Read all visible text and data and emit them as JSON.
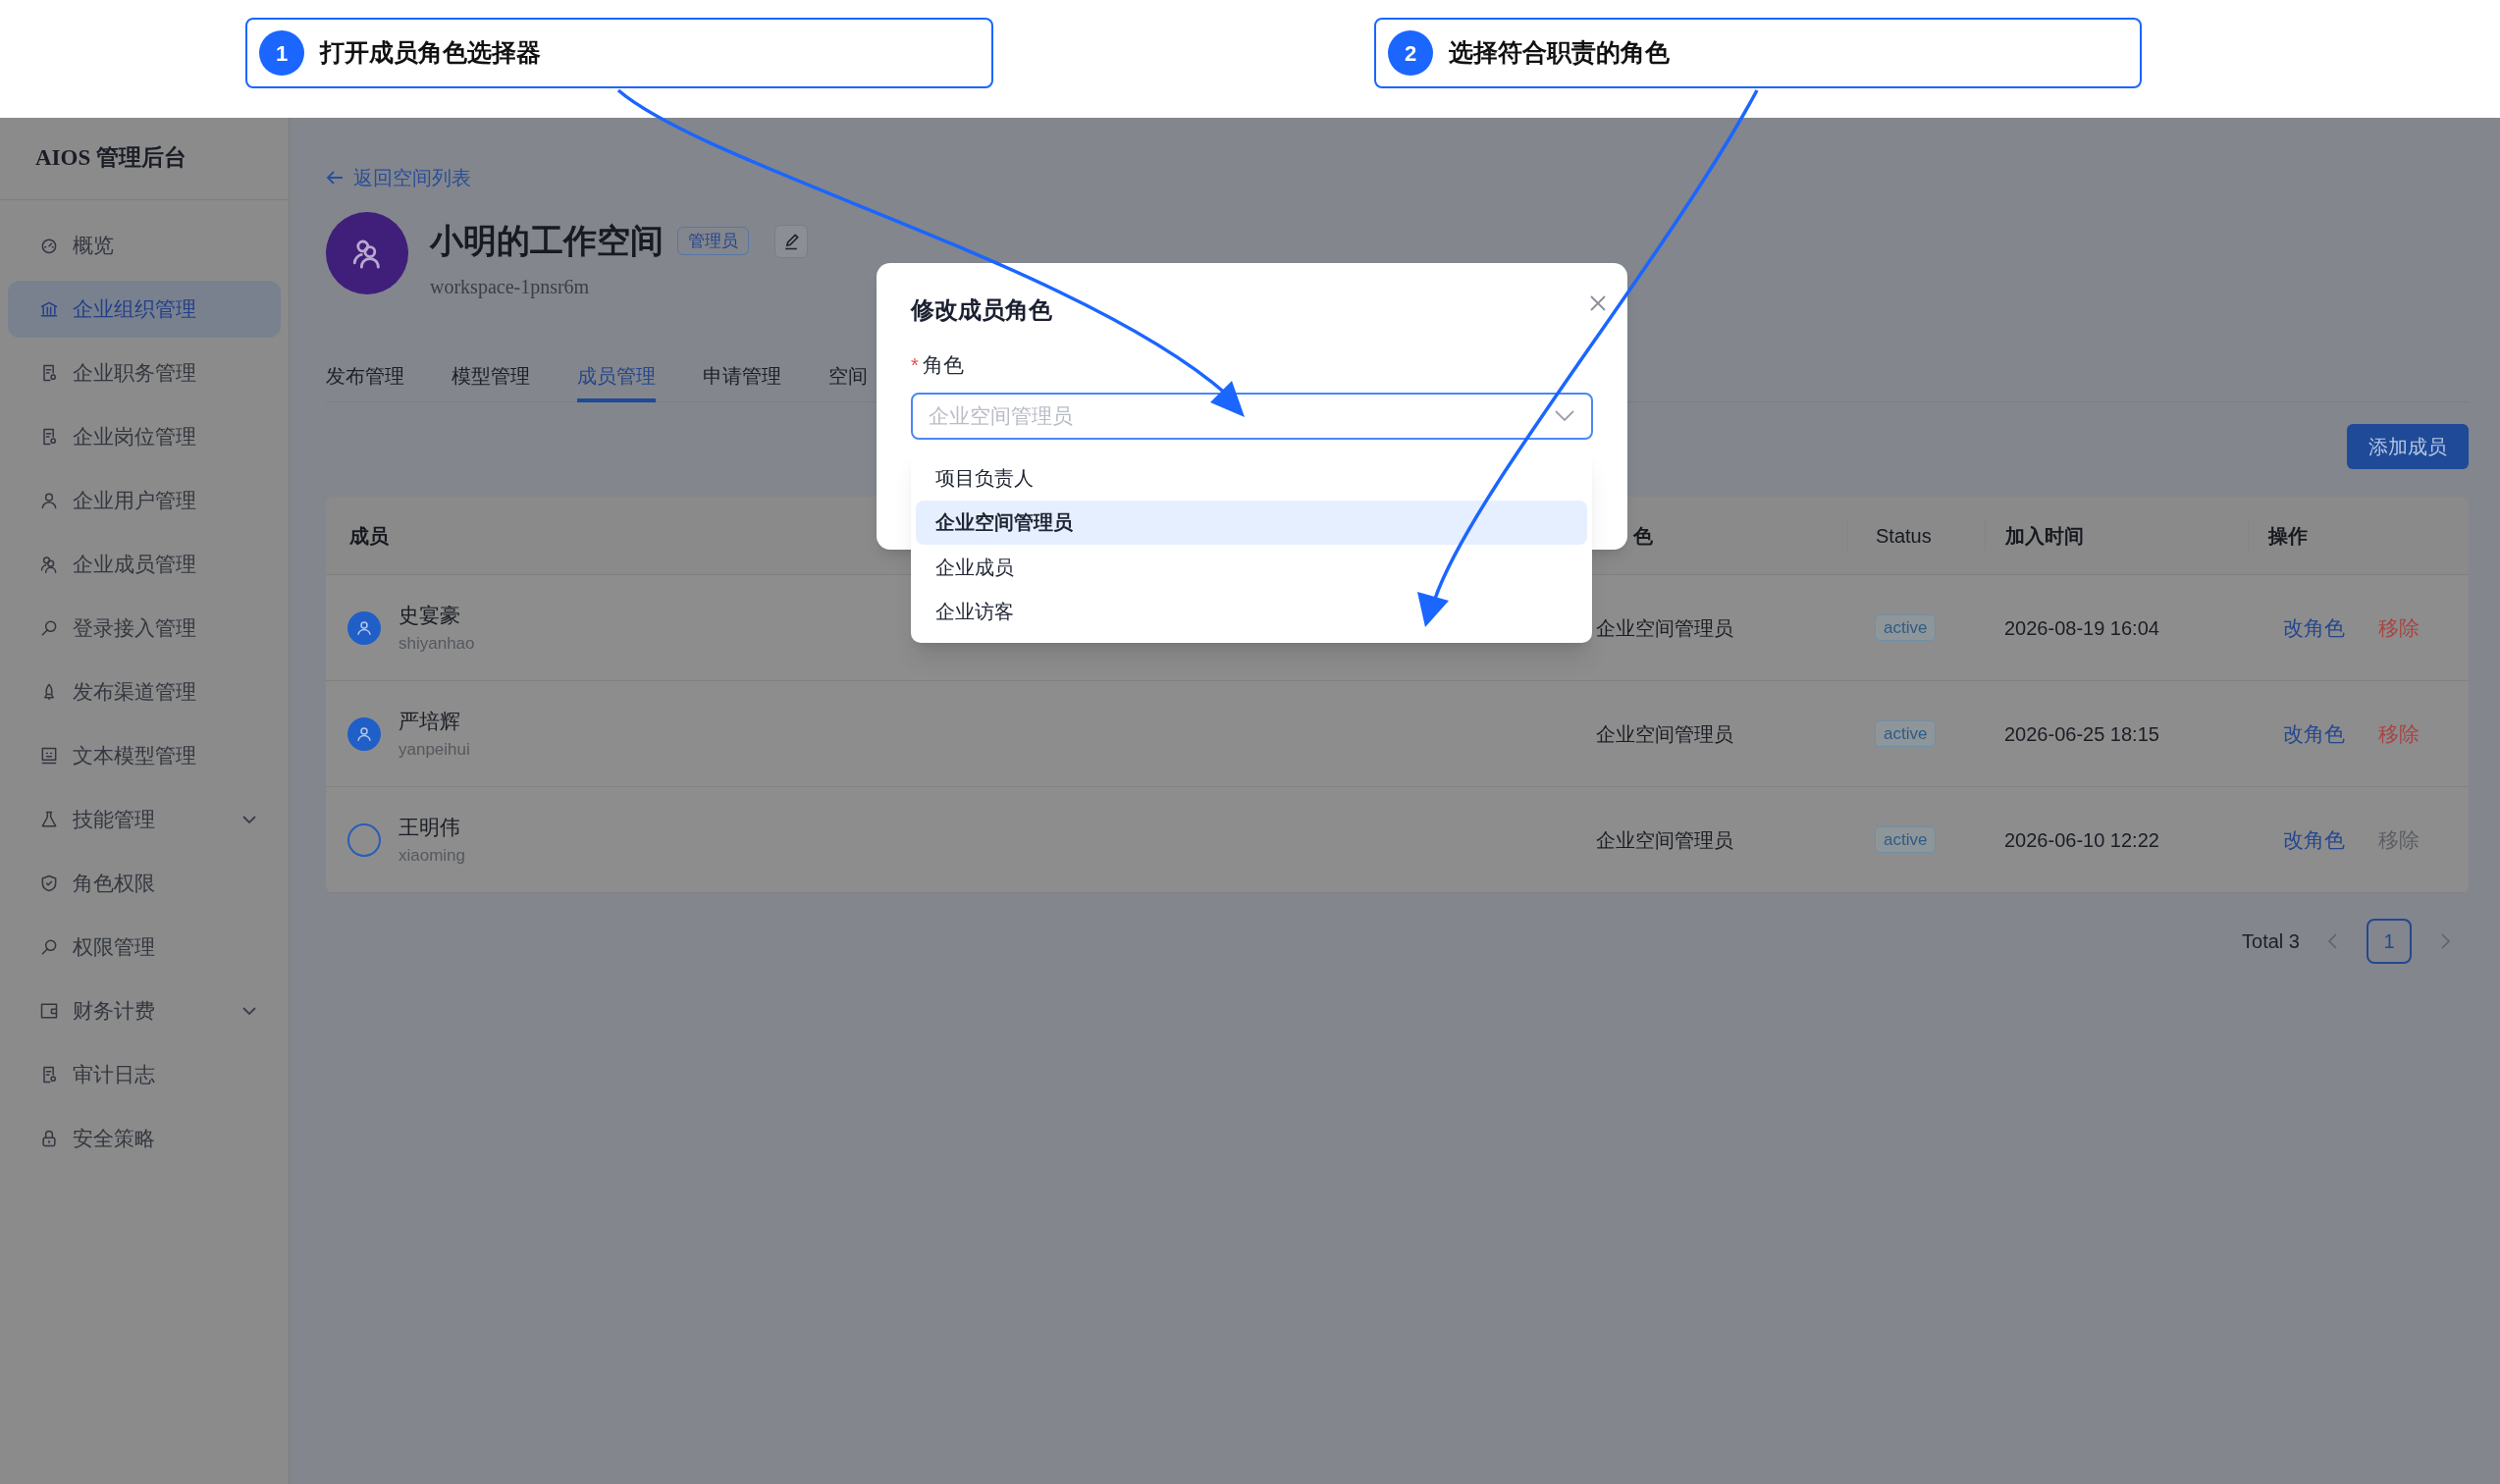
{
  "annotations": [
    {
      "number": "1",
      "text": "打开成员角色选择器"
    },
    {
      "number": "2",
      "text": "选择符合职责的角色"
    }
  ],
  "sidebar": {
    "title": "AIOS 管理后台",
    "items": [
      {
        "label": "概览",
        "selected": false
      },
      {
        "label": "企业组织管理",
        "selected": true
      },
      {
        "label": "企业职务管理",
        "selected": false
      },
      {
        "label": "企业岗位管理",
        "selected": false
      },
      {
        "label": "企业用户管理",
        "selected": false
      },
      {
        "label": "企业成员管理",
        "selected": false
      },
      {
        "label": "登录接入管理",
        "selected": false
      },
      {
        "label": "发布渠道管理",
        "selected": false
      },
      {
        "label": "文本模型管理",
        "selected": false
      },
      {
        "label": "技能管理",
        "selected": false,
        "expanded": false
      },
      {
        "label": "角色权限",
        "selected": false
      },
      {
        "label": "权限管理",
        "selected": false
      },
      {
        "label": "财务计费",
        "selected": false,
        "expanded": false
      },
      {
        "label": "审计日志",
        "selected": false
      },
      {
        "label": "安全策略",
        "selected": false
      }
    ]
  },
  "header": {
    "back_link": "返回空间列表",
    "workspace_name": "小明的工作空间",
    "badge": "管理员",
    "workspace_id": "workspace-1pnsr6m"
  },
  "tabs": [
    {
      "label": "发布管理",
      "selected": false
    },
    {
      "label": "模型管理",
      "selected": false
    },
    {
      "label": "成员管理",
      "selected": true
    },
    {
      "label": "申请管理",
      "selected": false
    },
    {
      "label": "空间",
      "selected": false
    }
  ],
  "add_button": "添加成员",
  "table": {
    "columns": [
      "成员",
      "色",
      "Status",
      "加入时间",
      "操作"
    ],
    "rows": [
      {
        "name": "史宴豪",
        "username": "shiyanhao",
        "avatar_filled": true,
        "role": "企业空间管理员",
        "status": "active",
        "joined": "2026-08-19 16:04",
        "actions": [
          {
            "label": "改角色",
            "kind": "link",
            "disabled": false
          },
          {
            "label": "移除",
            "kind": "danger",
            "disabled": false
          }
        ]
      },
      {
        "name": "严培辉",
        "username": "yanpeihui",
        "avatar_filled": true,
        "role": "企业空间管理员",
        "status": "active",
        "joined": "2026-06-25 18:15",
        "actions": [
          {
            "label": "改角色",
            "kind": "link",
            "disabled": false
          },
          {
            "label": "移除",
            "kind": "danger",
            "disabled": false
          }
        ]
      },
      {
        "name": "王明伟",
        "username": "xiaoming",
        "avatar_filled": false,
        "role": "企业空间管理员",
        "status": "active",
        "joined": "2026-06-10 12:22",
        "actions": [
          {
            "label": "改角色",
            "kind": "link",
            "disabled": false
          },
          {
            "label": "移除",
            "kind": "danger",
            "disabled": true
          }
        ]
      }
    ]
  },
  "pagination": {
    "total": "Total 3",
    "pages": [
      {
        "label": "1",
        "selected": true
      }
    ]
  },
  "modal": {
    "title": "修改成员角色",
    "field_label": "角色",
    "required_mark": "*",
    "placeholder": "企业空间管理员",
    "options": [
      {
        "label": "项目负责人",
        "selected": false
      },
      {
        "label": "企业空间管理员",
        "selected": true
      },
      {
        "label": "企业成员",
        "selected": false
      },
      {
        "label": "企业访客",
        "selected": false
      }
    ]
  }
}
